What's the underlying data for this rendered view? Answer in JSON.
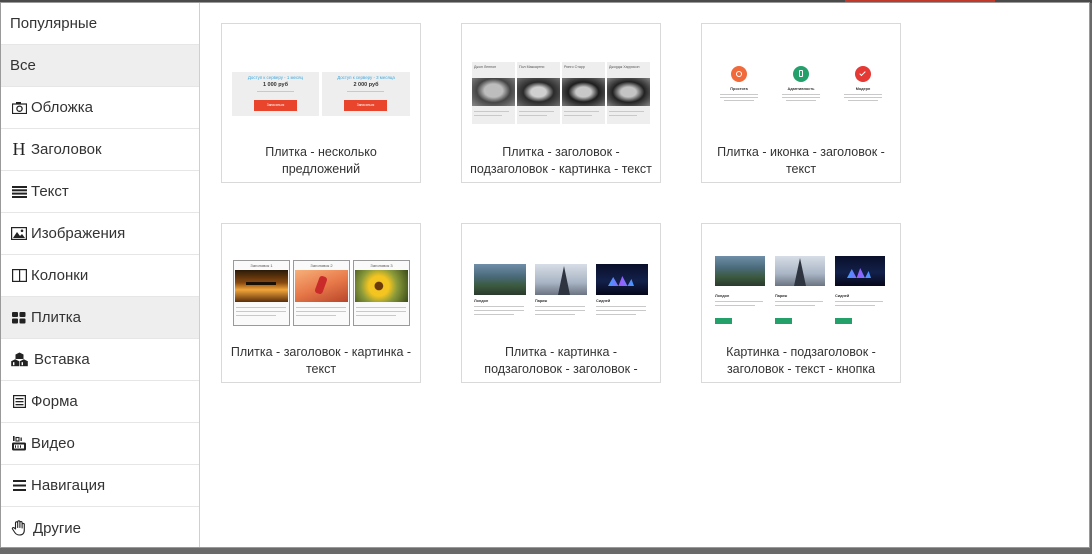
{
  "sidebar": {
    "items": [
      {
        "label": "Популярные",
        "icon": "none",
        "active": false
      },
      {
        "label": "Все",
        "icon": "none",
        "active": true
      },
      {
        "label": "Обложка",
        "icon": "camera-icon",
        "active": false
      },
      {
        "label": "Заголовок",
        "icon": "heading-icon",
        "active": false
      },
      {
        "label": "Текст",
        "icon": "text-lines-icon",
        "active": false
      },
      {
        "label": "Изображения",
        "icon": "image-icon",
        "active": false
      },
      {
        "label": "Колонки",
        "icon": "columns-icon",
        "active": false
      },
      {
        "label": "Плитка",
        "icon": "grid-icon",
        "active": true
      },
      {
        "label": "Вставка",
        "icon": "cubes-icon",
        "active": false
      },
      {
        "label": "Форма",
        "icon": "form-icon",
        "active": false
      },
      {
        "label": "Видео",
        "icon": "youtube-icon",
        "active": false
      },
      {
        "label": "Навигация",
        "icon": "menu-icon",
        "active": false
      },
      {
        "label": "Другие",
        "icon": "hand-icon",
        "active": false
      }
    ]
  },
  "cards": [
    {
      "caption": "Плитка - несколько предложений",
      "thumb": "offers"
    },
    {
      "caption": "Плитка - заголовок - подзаголовок - картинка - текст",
      "thumb": "beatles"
    },
    {
      "caption": "Плитка - иконка - заголовок - текст",
      "thumb": "icons"
    },
    {
      "caption": "Плитка - заголовок - картинка - текст",
      "thumb": "titles-images"
    },
    {
      "caption": "Плитка - картинка - подзаголовок - заголовок -",
      "thumb": "cities"
    },
    {
      "caption": "Картинка - подзаголовок - заголовок - текст - кнопка",
      "thumb": "cities-button"
    }
  ],
  "thumbs": {
    "offers": {
      "title1": "Доступ к серверу - 1 месяц",
      "price1": "1 000 руб",
      "title2": "Доступ к серверу - 3 месяца",
      "price2": "2 000 руб",
      "button": "Записаться"
    },
    "beatles": {
      "names": [
        "Джон Леннон",
        "Пол Маккартни",
        "Ринго Старр",
        "Джордж Харрисон"
      ]
    },
    "icons": {
      "titles": [
        "Простота",
        "Адаптивность",
        "Модерн"
      ]
    },
    "titles_images": {
      "titles": [
        "Заголовок 1",
        "Заголовок 2",
        "Заголовок 3"
      ]
    },
    "cities": {
      "names": [
        "Лондон",
        "Париж",
        "Сидней"
      ]
    }
  },
  "colors": {
    "accent_red": "#e8452c",
    "accent_green": "#24a06b",
    "offer_blue": "#3aa8e0",
    "orange": "#f06a3b",
    "active_bg": "#eeeeee"
  }
}
